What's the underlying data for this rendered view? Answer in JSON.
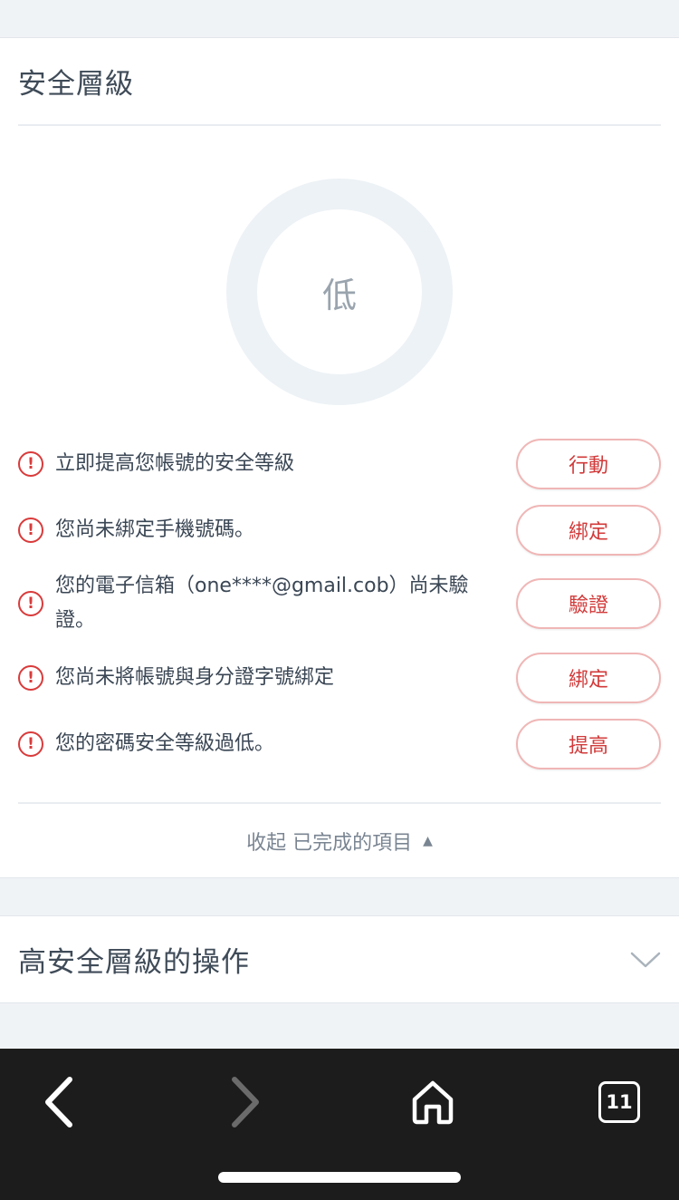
{
  "security_card": {
    "title": "安全層級",
    "level_label": "低",
    "issues": [
      {
        "text": "立即提高您帳號的安全等級",
        "action": "行動"
      },
      {
        "text": "您尚未綁定手機號碼。",
        "action": "綁定"
      },
      {
        "text": "您的電子信箱（one****@gmail.cob）尚未驗證。",
        "action": "驗證"
      },
      {
        "text": "您尚未將帳號與身分證字號綁定",
        "action": "綁定"
      },
      {
        "text": "您的密碼安全等級過低。",
        "action": "提高"
      }
    ],
    "collapse_label": "收起 已完成的項目",
    "collapse_arrow": "▲"
  },
  "ops_card": {
    "title": "高安全層級的操作"
  },
  "browser": {
    "tab_count": "11"
  },
  "colors": {
    "accent_red": "#d23a3a",
    "ring": "#edf2f6",
    "bar": "#1c1c1c"
  }
}
